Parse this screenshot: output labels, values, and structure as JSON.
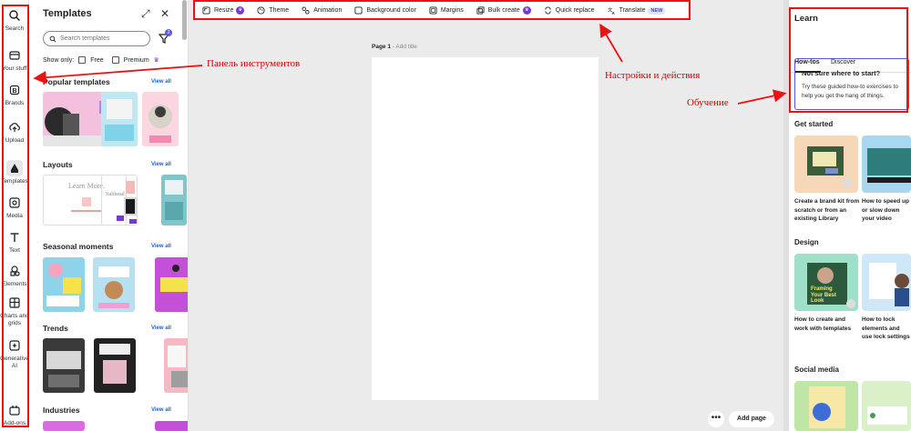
{
  "rail": {
    "items": [
      {
        "label": "Search"
      },
      {
        "label": "Your stuff"
      },
      {
        "label": "Brands"
      },
      {
        "label": "Upload"
      },
      {
        "label": "Templates"
      },
      {
        "label": "Media"
      },
      {
        "label": "Text"
      },
      {
        "label": "Elements"
      },
      {
        "label": "Charts and grids"
      },
      {
        "label": "Generative AI"
      },
      {
        "label": "Add-ons"
      }
    ]
  },
  "panel": {
    "title": "Templates",
    "search_placeholder": "Search templates",
    "filter_count": "2",
    "show_only": "Show only:",
    "free": "Free",
    "premium": "Premium",
    "view_all": "View all",
    "sections": [
      "Popular templates",
      "Layouts",
      "Seasonal moments",
      "Trends",
      "Industries"
    ],
    "layout_texts": [
      "Learn More.",
      "Subhead"
    ]
  },
  "toolbar": {
    "items": [
      "Resize",
      "Theme",
      "Animation",
      "Background color",
      "Margins",
      "Bulk create",
      "Quick replace",
      "Translate"
    ],
    "new_badge": "NEW"
  },
  "canvas": {
    "page_label": "Page 1",
    "page_title_placeholder": "- Add title",
    "add_page": "Add page",
    "more": "•••"
  },
  "learn": {
    "title": "Learn",
    "tabs": [
      "How-tos",
      "Discover"
    ],
    "card_title": "Not sure where to start?",
    "card_text": "Try these guided how-to exercises to help you get the hang of things.",
    "sections": [
      "Get started",
      "Design",
      "Social media"
    ],
    "captions": [
      "Create a brand kit from scratch or from an existing Library",
      "How to speed up or slow down your video",
      "How to create and work with templates",
      "How to lock elements and use lock settings"
    ],
    "thumb_texts": [
      "Framing Your Best Look"
    ]
  },
  "annotations": {
    "toolbar_label": "Панель инструментов",
    "settings_label": "Настройки и действия",
    "learning_label": "Обучение"
  },
  "colors": {
    "accent_purple": "#7a37d8",
    "link_blue": "#1d5fd6",
    "annotation_red": "#e11111"
  }
}
